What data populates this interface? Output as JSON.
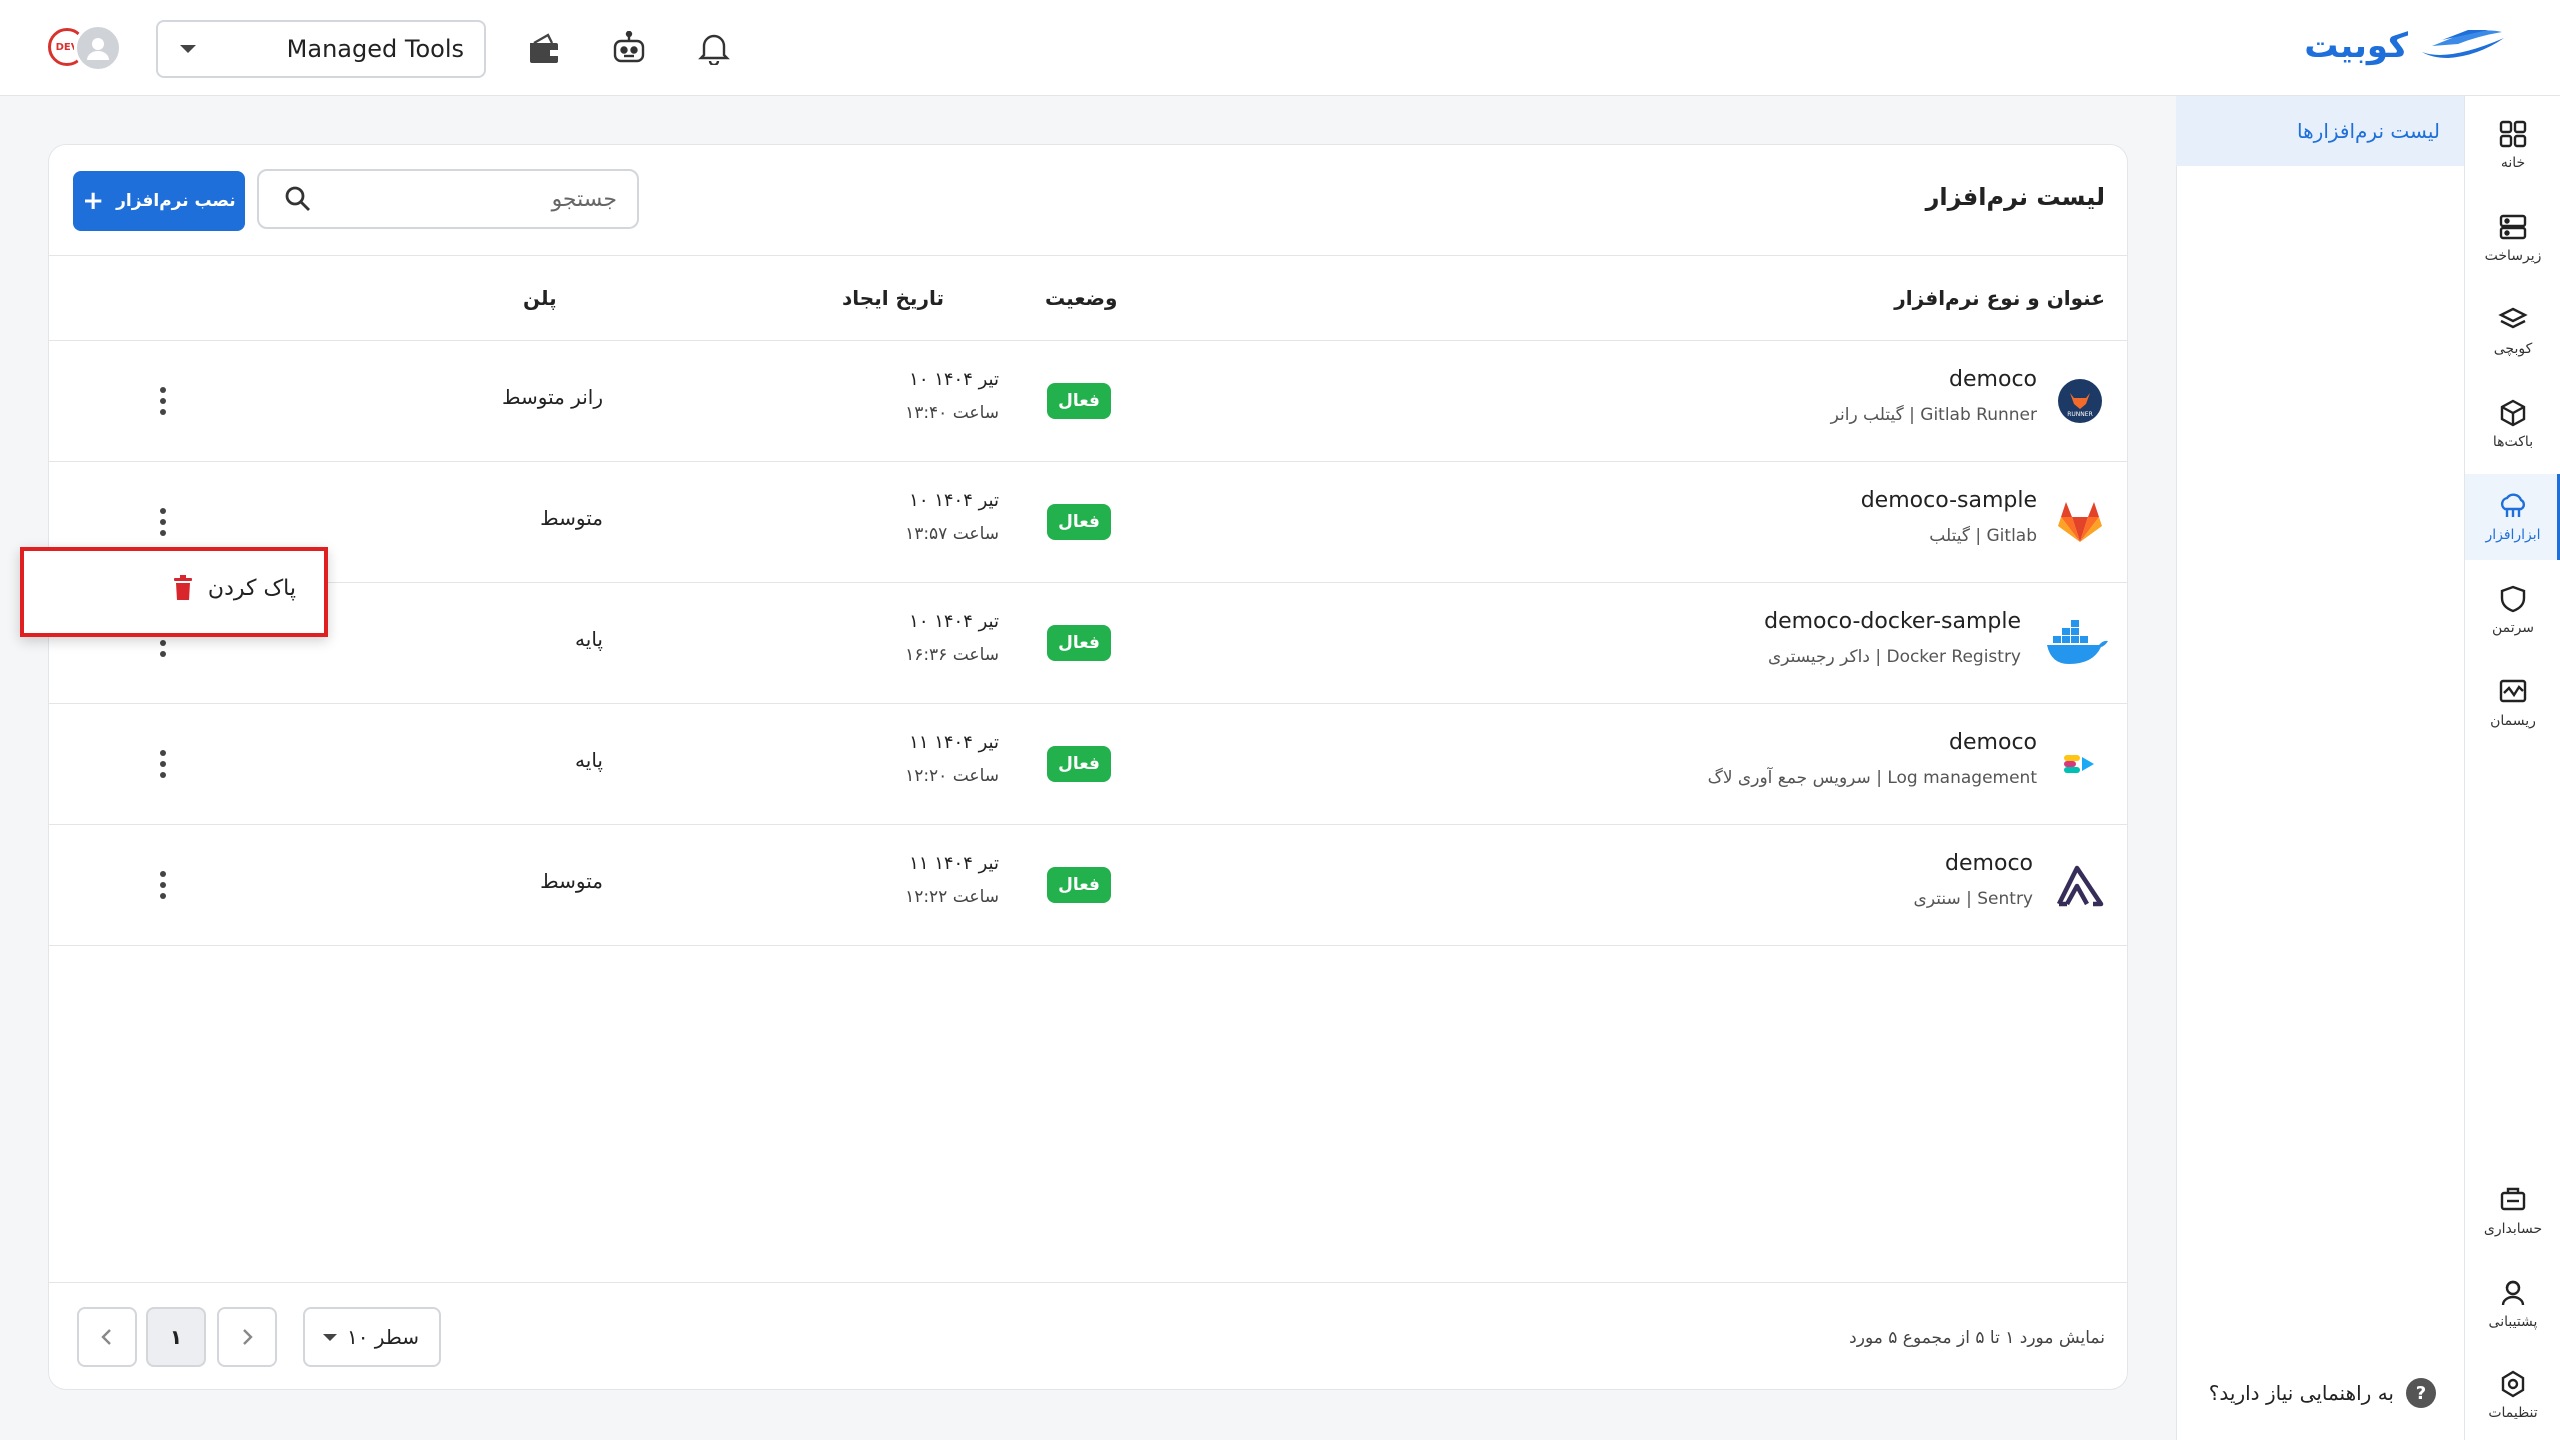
{
  "header": {
    "brand": "کوبیت",
    "tool_selector": "Managed Tools",
    "avatar_badge": "DEV"
  },
  "rail": {
    "items": [
      {
        "label": "خانه",
        "icon": "grid-icon"
      },
      {
        "label": "زیرساخت",
        "icon": "server-icon"
      },
      {
        "label": "کوبچی",
        "icon": "layers-icon"
      },
      {
        "label": "باکت‌ها",
        "icon": "cube-icon"
      },
      {
        "label": "ابزارافزار",
        "icon": "tool-cloud-icon",
        "active": true
      },
      {
        "label": "سرتمن",
        "icon": "shield-icon"
      },
      {
        "label": "ریسمان",
        "icon": "monitor-chart-icon"
      },
      {
        "label": "حسابداری",
        "icon": "accounting-icon"
      },
      {
        "label": "پشتیبانی",
        "icon": "support-icon"
      },
      {
        "label": "تنظیمات",
        "icon": "settings-icon"
      }
    ]
  },
  "subnav": {
    "active_item": "لیست نرم‌افزارها",
    "help": "به راهنمایی نیاز دارید؟",
    "help_mark": "?"
  },
  "main": {
    "title": "لیست نرم‌افزار",
    "search_placeholder": "جستجو",
    "install_button": "نصب نرم‌افزار",
    "columns": {
      "title_type": "عنوان و نوع نرم‌افزار",
      "status": "وضعیت",
      "created": "تاریخ ایجاد",
      "plan": "پلن"
    },
    "rows": [
      {
        "name": "democo",
        "type": "گیتلب رانر | Gitlab Runner",
        "status": "فعال",
        "date": "۱۰ تیر ۱۴۰۴",
        "time": "ساعت ۱۳:۴۰",
        "plan": "رانر متوسط",
        "icon": "gitlab-runner-icon"
      },
      {
        "name": "democo-sample",
        "type": "گیتلب | Gitlab",
        "status": "فعال",
        "date": "۱۰ تیر ۱۴۰۴",
        "time": "ساعت ۱۳:۵۷",
        "plan": "متوسط",
        "icon": "gitlab-icon"
      },
      {
        "name": "democo-docker-sample",
        "type": "داکر رجیستری | Docker Registry",
        "status": "فعال",
        "date": "۱۰ تیر ۱۴۰۴",
        "time": "ساعت ۱۶:۳۶",
        "plan": "پایه",
        "icon": "docker-icon"
      },
      {
        "name": "democo",
        "type": "سرویس جمع آوری لاگ | Log management",
        "status": "فعال",
        "date": "۱۱ تیر ۱۴۰۴",
        "time": "ساعت ۱۲:۲۰",
        "plan": "پایه",
        "icon": "elastic-icon"
      },
      {
        "name": "democo",
        "type": "سنتری | Sentry",
        "status": "فعال",
        "date": "۱۱ تیر ۱۴۰۴",
        "time": "ساعت ۱۲:۲۲",
        "plan": "متوسط",
        "icon": "sentry-icon"
      }
    ],
    "footer": {
      "info": "نمایش مورد ۱ تا ۵ از مجموع ۵ مورد",
      "rows_per_page": "۱۰ سطر",
      "current_page": "۱"
    }
  },
  "popup": {
    "delete_label": "پاک کردن"
  },
  "colors": {
    "primary": "#1e6fd9",
    "status_active": "#22b14c",
    "delete": "#e02020"
  }
}
